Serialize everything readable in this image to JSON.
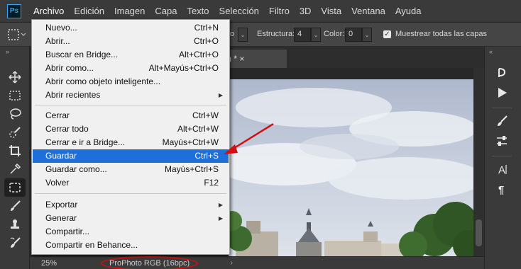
{
  "app": {
    "logo_text": "Ps"
  },
  "menubar": {
    "items": [
      "Archivo",
      "Edición",
      "Imagen",
      "Capa",
      "Texto",
      "Selección",
      "Filtro",
      "3D",
      "Vista",
      "Ventana",
      "Ayuda"
    ],
    "active": "Archivo"
  },
  "options": {
    "mode_partial": "o",
    "structure_label": "Estructura:",
    "structure_value": "4",
    "color_label": "Color:",
    "color_value": "0",
    "sample_all_label": "Muestrear todas las capas",
    "sample_all_checked": true
  },
  "document": {
    "tab_partial": ") * ×"
  },
  "status": {
    "zoom": "25%",
    "color_profile": "ProPhoto RGB (16bpc)",
    "arrow": "›"
  },
  "file_menu": {
    "items": [
      {
        "label": "Nuevo...",
        "shortcut": "Ctrl+N"
      },
      {
        "label": "Abrir...",
        "shortcut": "Ctrl+O"
      },
      {
        "label": "Buscar en Bridge...",
        "shortcut": "Alt+Ctrl+O"
      },
      {
        "label": "Abrir como...",
        "shortcut": "Alt+Mayús+Ctrl+O"
      },
      {
        "label": "Abrir como objeto inteligente...",
        "shortcut": ""
      },
      {
        "label": "Abrir recientes",
        "shortcut": "",
        "submenu": true
      },
      {
        "label": "Cerrar",
        "shortcut": "Ctrl+W"
      },
      {
        "label": "Cerrar todo",
        "shortcut": "Alt+Ctrl+W"
      },
      {
        "label": "Cerrar e ir a Bridge...",
        "shortcut": "Mayús+Ctrl+W"
      },
      {
        "label": "Guardar",
        "shortcut": "Ctrl+S",
        "highlighted": true
      },
      {
        "label": "Guardar como...",
        "shortcut": "Mayús+Ctrl+S"
      },
      {
        "label": "Volver",
        "shortcut": "F12"
      },
      {
        "label": "Exportar",
        "shortcut": "",
        "submenu": true
      },
      {
        "label": "Generar",
        "shortcut": "",
        "submenu": true
      },
      {
        "label": "Compartir...",
        "shortcut": ""
      },
      {
        "label": "Compartir en Behance...",
        "shortcut": ""
      }
    ]
  },
  "colors": {
    "highlight": "#1e6fd9",
    "annotation_red": "#d01010",
    "menubar_bg": "#3a3a3a",
    "menu_bg": "#f0f0f0"
  },
  "icons": {
    "toolbar": [
      "move-icon",
      "marquee-icon",
      "lasso-icon",
      "quick-selection-icon",
      "crop-icon",
      "eyedropper-icon",
      "patch-icon",
      "brush-icon",
      "clone-stamp-icon",
      "history-brush-icon"
    ],
    "right_dock": [
      "history-icon",
      "play-icon",
      "brush-settings-icon",
      "adjustments-icon",
      "character-icon",
      "paragraph-icon"
    ]
  }
}
